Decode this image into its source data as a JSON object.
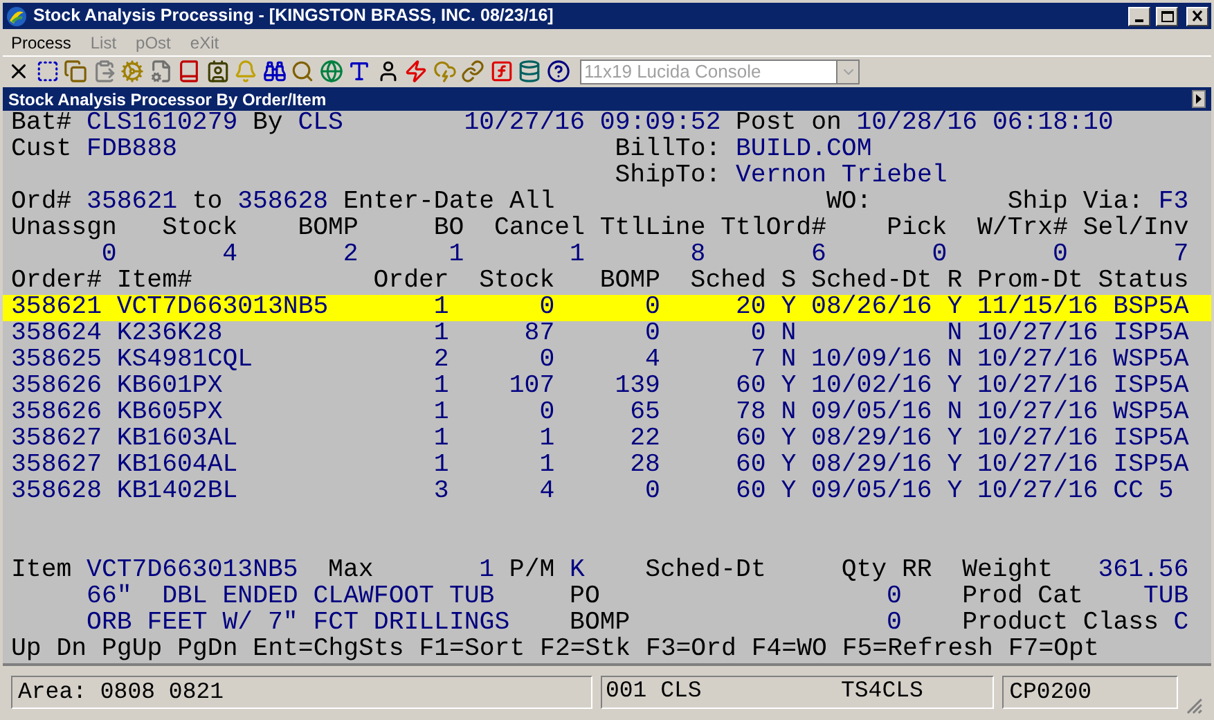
{
  "window": {
    "title": "Stock Analysis Processing - [KINGSTON BRASS, INC. 08/23/16]"
  },
  "menu": [
    {
      "label": "Process",
      "disabled": false
    },
    {
      "label": "List",
      "disabled": true
    },
    {
      "label": "pOst",
      "disabled": true
    },
    {
      "label": "eXit",
      "disabled": true
    }
  ],
  "toolbar": {
    "font_select": {
      "value": "11x19 Lucida Console",
      "disabled": true
    }
  },
  "panel_title": "Stock Analysis Processor By Order/Item",
  "header": {
    "batch_label": "Bat#",
    "batch": "CLS1610279",
    "by_label": "By",
    "by": "CLS",
    "created": "10/27/16 09:09:52",
    "post_label": "Post on",
    "post": "10/28/16 06:18:10",
    "cust_label": "Cust",
    "cust": "FDB888",
    "billto_label": "BillTo:",
    "billto": "BUILD.COM",
    "shipto_label": "ShipTo:",
    "shipto": "Vernon Triebel",
    "ord_label": "Ord#",
    "ord_from": "358621",
    "to_label": "to",
    "ord_to": "358628",
    "enter_date": "Enter-Date All",
    "wo_label": "WO:",
    "shipvia_label": "Ship Via:",
    "shipvia": "F3"
  },
  "totals": [
    {
      "label": "Unassgn",
      "value": "0"
    },
    {
      "label": "Stock",
      "value": "4"
    },
    {
      "label": "BOMP",
      "value": "2"
    },
    {
      "label": "BO",
      "value": "1"
    },
    {
      "label": "Cancel",
      "value": "1"
    },
    {
      "label": "TtlLine",
      "value": "8"
    },
    {
      "label": "TtlOrd#",
      "value": "6"
    },
    {
      "label": "Pick",
      "value": "0"
    },
    {
      "label": "W/Trx#",
      "value": "0"
    },
    {
      "label": "Sel/Inv",
      "value": "7"
    }
  ],
  "table": {
    "columns": [
      "Order#",
      "Item#",
      "Order",
      "Stock",
      "BOMP",
      "Sched",
      "S",
      "Sched-Dt",
      "R",
      "Prom-Dt",
      "Status"
    ],
    "rows": [
      {
        "selected": true,
        "order": "358621",
        "item": "VCT7D663013NB5",
        "qty": "1",
        "stock": "0",
        "bomp": "0",
        "sched": "20",
        "s": "Y",
        "sched_dt": "08/26/16",
        "r": "Y",
        "prom_dt": "11/15/16",
        "status": "BSP5A"
      },
      {
        "selected": false,
        "order": "358624",
        "item": "K236K28",
        "qty": "1",
        "stock": "87",
        "bomp": "0",
        "sched": "0",
        "s": "N",
        "r": "N",
        "prom_dt": "10/27/16",
        "status": "ISP5A"
      },
      {
        "selected": false,
        "order": "358625",
        "item": "KS4981CQL",
        "qty": "2",
        "stock": "0",
        "bomp": "4",
        "sched": "7",
        "s": "N",
        "sched_dt": "10/09/16",
        "r": "N",
        "prom_dt": "10/27/16",
        "status": "WSP5A"
      },
      {
        "selected": false,
        "order": "358626",
        "item": "KB601PX",
        "qty": "1",
        "stock": "107",
        "bomp": "139",
        "sched": "60",
        "s": "Y",
        "sched_dt": "10/02/16",
        "r": "Y",
        "prom_dt": "10/27/16",
        "status": "ISP5A"
      },
      {
        "selected": false,
        "order": "358626",
        "item": "KB605PX",
        "qty": "1",
        "stock": "0",
        "bomp": "65",
        "sched": "78",
        "s": "N",
        "sched_dt": "09/05/16",
        "r": "N",
        "prom_dt": "10/27/16",
        "status": "WSP5A"
      },
      {
        "selected": false,
        "order": "358627",
        "item": "KB1603AL",
        "qty": "1",
        "stock": "1",
        "bomp": "22",
        "sched": "60",
        "s": "Y",
        "sched_dt": "08/29/16",
        "r": "Y",
        "prom_dt": "10/27/16",
        "status": "ISP5A"
      },
      {
        "selected": false,
        "order": "358627",
        "item": "KB1604AL",
        "qty": "1",
        "stock": "1",
        "bomp": "28",
        "sched": "60",
        "s": "Y",
        "sched_dt": "08/29/16",
        "r": "Y",
        "prom_dt": "10/27/16",
        "status": "ISP5A"
      },
      {
        "selected": false,
        "order": "358628",
        "item": "KB1402BL",
        "qty": "3",
        "stock": "4",
        "bomp": "0",
        "sched": "60",
        "s": "Y",
        "sched_dt": "09/05/16",
        "r": "Y",
        "prom_dt": "10/27/16",
        "status": "CC 5"
      }
    ]
  },
  "detail": {
    "item_label": "Item",
    "item": "VCT7D663013NB5",
    "max_label": "Max",
    "max": "1",
    "pm_label": "P/M",
    "pm": "K",
    "sched_label": "Sched-Dt",
    "qty_label": "Qty",
    "rr_label": "RR",
    "weight_label": "Weight",
    "weight": "361.56",
    "desc1": "66\"  DBL ENDED CLAWFOOT TUB",
    "po_label": "PO",
    "po": "0",
    "prodcat_label": "Prod Cat",
    "prodcat": "TUB",
    "desc2": "ORB FEET W/ 7\" FCT DRILLINGS",
    "bomp_label": "BOMP",
    "bomp": "0",
    "class_label": "Product Class",
    "class": "C"
  },
  "function_keys": [
    "Up",
    "Dn",
    "PgUp",
    "PgDn",
    "Ent=ChgSts",
    "F1=Sort",
    "F2=Stk",
    "F3=Ord",
    "F4=WO",
    "F5=Refresh",
    "F7=Opt"
  ],
  "status_bar": [
    "Area: 0808 0821",
    "001 CLS",
    "TS4CLS",
    "CP0200"
  ]
}
